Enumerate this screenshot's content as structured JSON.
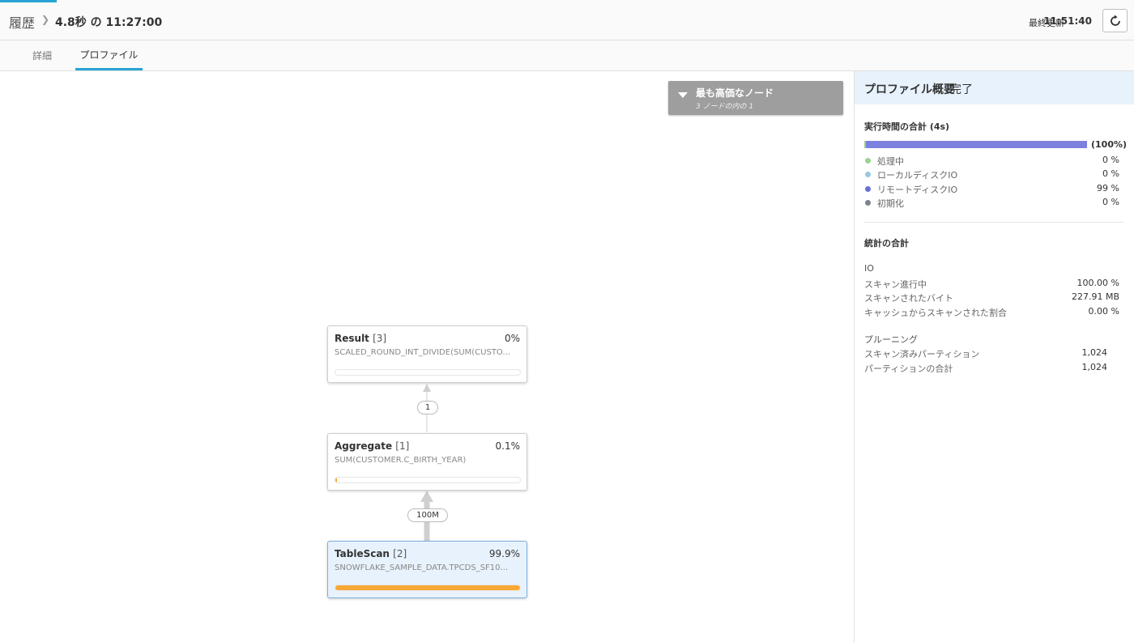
{
  "header": {
    "breadcrumb_root": "履歴",
    "title": "4.8秒 の 11:27:00",
    "last_updated_label": "最終更新",
    "last_updated_time": "11:51:40"
  },
  "tabs": [
    {
      "label": "詳細",
      "active": false
    },
    {
      "label": "プロファイル",
      "active": true
    }
  ],
  "costly_nodes": {
    "title": "最も高価なノード",
    "subtitle": "3 ノードの内の 1"
  },
  "nodes": [
    {
      "name": "Result",
      "id": "[3]",
      "percent": "0%",
      "detail": "SCALED_ROUND_INT_DIVIDE(SUM(CUSTO...",
      "fill": 0.0
    },
    {
      "name": "Aggregate",
      "id": "[1]",
      "percent": "0.1%",
      "detail": "SUM(CUSTOMER.C_BIRTH_YEAR)",
      "fill": 0.01
    },
    {
      "name": "TableScan",
      "id": "[2]",
      "percent": "99.9%",
      "detail": "SNOWFLAKE_SAMPLE_DATA.TPCDS_SF10...",
      "fill": 0.999
    }
  ],
  "edges": [
    {
      "label": "1"
    },
    {
      "label": "100M"
    }
  ],
  "profile": {
    "title": "プロファイル概要",
    "status": "完了",
    "execution_title": "実行時間の合計 (4s)",
    "execution_total_pct": "(100%)",
    "legend": [
      {
        "label": "処理中",
        "value": "0 %",
        "color": "#9bd38f"
      },
      {
        "label": "ローカルディスクIO",
        "value": "0 %",
        "color": "#9ac8df"
      },
      {
        "label": "リモートディスクIO",
        "value": "99 %",
        "color": "#6a6fd8"
      },
      {
        "label": "初期化",
        "value": "0 %",
        "color": "#7c8190"
      }
    ],
    "stats_title": "統計の合計",
    "io": {
      "title": "IO",
      "rows": [
        {
          "label": "スキャン進行中",
          "value": "100.00 %"
        },
        {
          "label": "スキャンされたバイト",
          "value": "227.91 MB"
        },
        {
          "label": "キャッシュからスキャンされた割合",
          "value": "0.00 %"
        }
      ]
    },
    "pruning": {
      "title": "プルーニング",
      "rows": [
        {
          "label": "スキャン済みパーティション",
          "value": "1,024"
        },
        {
          "label": "パーティションの合計",
          "value": "1,024"
        }
      ]
    }
  },
  "icons": {
    "refresh": "refresh-icon",
    "breadcrumb_separator": "chevron-right-icon",
    "dropdown": "caret-down-icon"
  }
}
